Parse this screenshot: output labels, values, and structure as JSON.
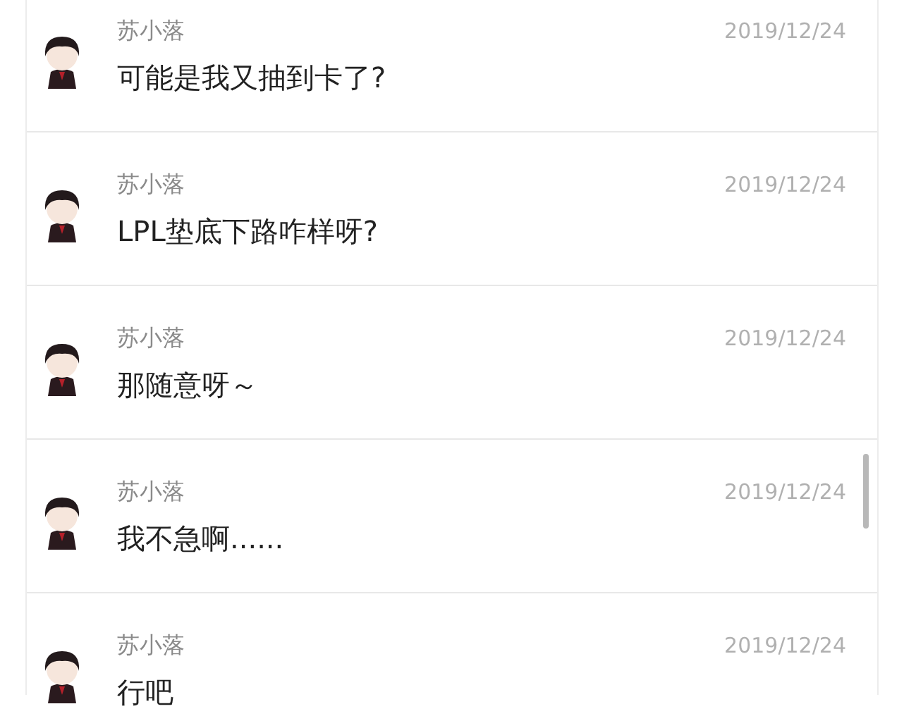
{
  "messages": [
    {
      "name": "苏小落",
      "date": "2019/12/24",
      "text": "可能是我又抽到卡了?"
    },
    {
      "name": "苏小落",
      "date": "2019/12/24",
      "text": "LPL垫底下路咋样呀?"
    },
    {
      "name": "苏小落",
      "date": "2019/12/24",
      "text": "那随意呀～"
    },
    {
      "name": "苏小落",
      "date": "2019/12/24",
      "text": "我不急啊......"
    },
    {
      "name": "苏小落",
      "date": "2019/12/24",
      "text": "行吧"
    }
  ]
}
